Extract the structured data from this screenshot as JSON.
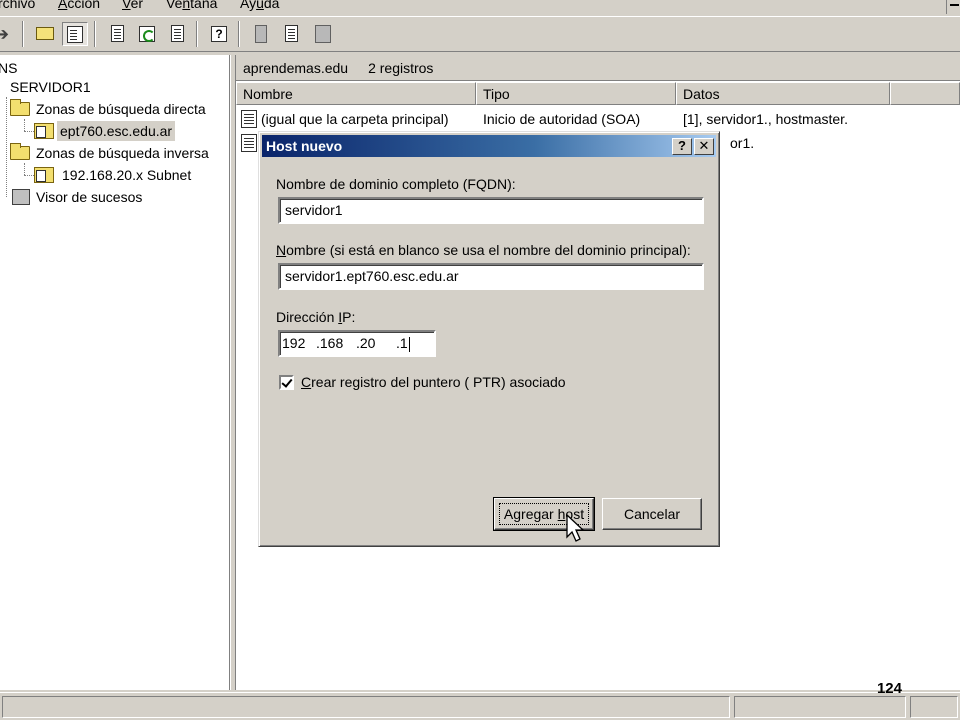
{
  "menu": {
    "items": [
      {
        "pre": "",
        "u": "A",
        "post": "rchivo",
        "visible": "rchivo"
      },
      {
        "pre": "",
        "u": "A",
        "post": "cción",
        "visible": "Acción"
      },
      {
        "pre": "",
        "u": "V",
        "post": "er",
        "visible": "Ver"
      },
      {
        "pre": "Ve",
        "u": "n",
        "post": "tana",
        "visible": "Ventana"
      },
      {
        "pre": "Ay",
        "u": "u",
        "post": "da",
        "visible": "Ayuda"
      }
    ]
  },
  "toolbar": {
    "icons": [
      "back-arrow-icon",
      "up-folder-icon",
      "show-hide-tree-icon",
      "properties-icon",
      "refresh-icon",
      "export-list-icon",
      "help-icon",
      "record-icon-1",
      "record-icon-2",
      "record-icon-3"
    ]
  },
  "tree": {
    "root_label": "NS",
    "server_label": "SERVIDOR1",
    "forward_zones_label": "Zonas de búsqueda directa",
    "forward_zone_item": "ept760.esc.edu.ar",
    "reverse_zones_label": "Zonas de búsqueda inversa",
    "reverse_zone_item": "192.168.20.x Subnet",
    "event_viewer_label": "Visor de sucesos"
  },
  "right_pane": {
    "zone_name": "aprendemas.edu",
    "record_count": "2 registros",
    "columns": {
      "name": "Nombre",
      "type": "Tipo",
      "data": "Datos"
    },
    "rows": [
      {
        "name": "(igual que la carpeta principal)",
        "type": "Inicio de autoridad (SOA)",
        "data": "[1], servidor1., hostmaster."
      },
      {
        "name": "",
        "type": "",
        "data": "or1."
      }
    ]
  },
  "dialog": {
    "title": "Host nuevo",
    "help_btn": "?",
    "close_btn": "✕",
    "fqdn_label": "Nombre de dominio completo (FQDN):",
    "fqdn_value": "servidor1",
    "name_label_pre": "",
    "name_label_u": "N",
    "name_label_post": "ombre (si está en blanco se usa el nombre del dominio principal):",
    "name_value": "servidor1.ept760.esc.edu.ar",
    "ip_label_pre": "Dirección ",
    "ip_label_u": "I",
    "ip_label_post": "P:",
    "ip_octets": [
      "192",
      ".168",
      ".20",
      ".1"
    ],
    "ptr_checked": true,
    "ptr_label_pre": "",
    "ptr_label_u": "C",
    "ptr_label_post": "rear registro del puntero ( PTR) asociado",
    "add_btn_pre": "Agregar ",
    "add_btn_u": "h",
    "add_btn_post": "ost",
    "cancel_btn": "Cancelar"
  },
  "page_number": "124"
}
